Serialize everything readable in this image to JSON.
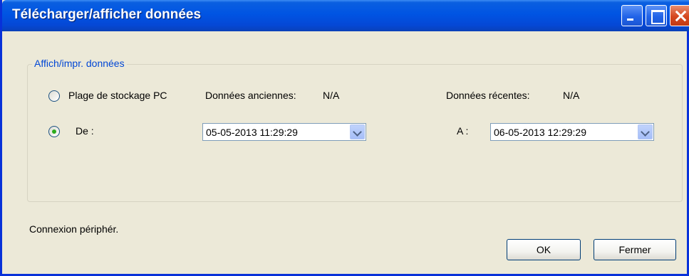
{
  "window": {
    "title": "Télécharger/afficher données"
  },
  "group": {
    "legend": "Affich/impr. données"
  },
  "range": {
    "storage_label": "Plage de stockage PC",
    "old_data_label": "Données anciennes:",
    "old_data_value": "N/A",
    "recent_data_label": "Données récentes:",
    "recent_data_value": "N/A",
    "storage_selected": false
  },
  "from": {
    "label": "De :",
    "selected": true,
    "value": "05-05-2013 11:29:29"
  },
  "to": {
    "label": "A :",
    "value": "06-05-2013 12:29:29"
  },
  "status": {
    "text": "Connexion périphér."
  },
  "buttons": {
    "ok": "OK",
    "close": "Fermer"
  }
}
